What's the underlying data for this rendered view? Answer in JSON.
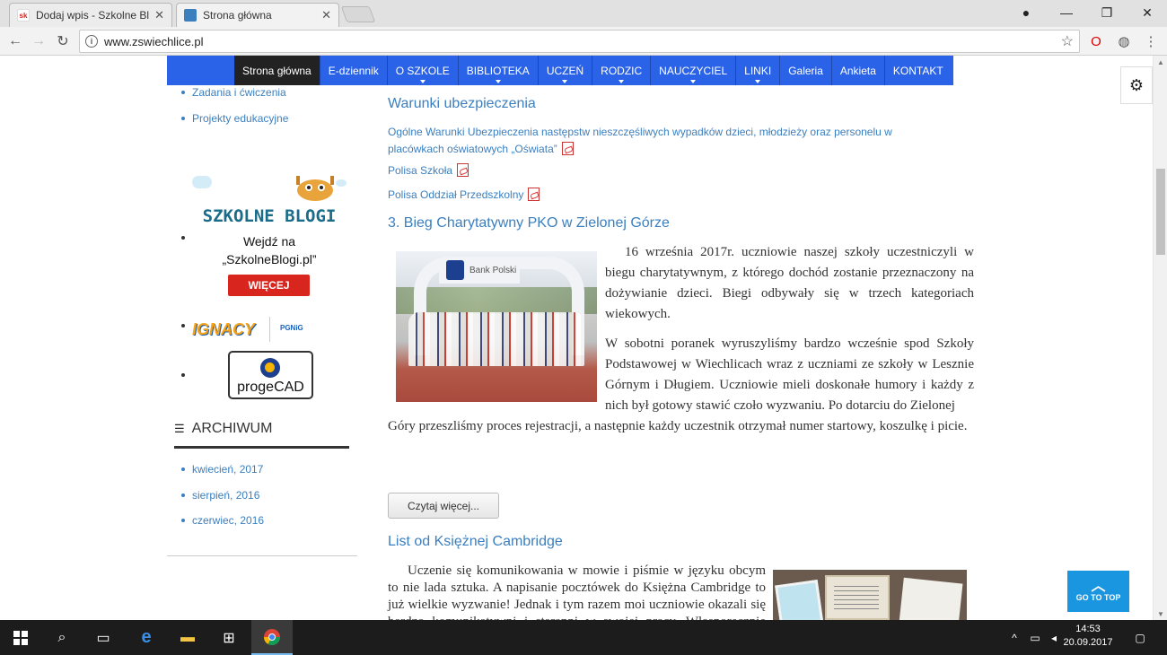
{
  "browser": {
    "tabs": [
      {
        "title": "Dodaj wpis - Szkolne Blo",
        "favicon": "sk"
      },
      {
        "title": "Strona główna",
        "favicon": "shield"
      }
    ],
    "url": "www.zswiechlice.pl"
  },
  "site_nav": {
    "items": [
      {
        "label": "Strona główna",
        "active": true,
        "dropdown": false
      },
      {
        "label": "E-dziennik",
        "active": false,
        "dropdown": false
      },
      {
        "label": "O SZKOLE",
        "active": false,
        "dropdown": true
      },
      {
        "label": "BIBLIOTEKA",
        "active": false,
        "dropdown": true
      },
      {
        "label": "UCZEŃ",
        "active": false,
        "dropdown": true
      },
      {
        "label": "RODZIC",
        "active": false,
        "dropdown": true
      },
      {
        "label": "NAUCZYCIEL",
        "active": false,
        "dropdown": true
      },
      {
        "label": "LINKI",
        "active": false,
        "dropdown": true
      },
      {
        "label": "Galeria",
        "active": false,
        "dropdown": false
      },
      {
        "label": "Ankieta",
        "active": false,
        "dropdown": false
      },
      {
        "label": "KONTAKT",
        "active": false,
        "dropdown": false
      }
    ]
  },
  "sidebar": {
    "links": [
      "Zadania i ćwiczenia",
      "Projekty edukacyjne"
    ],
    "szkolne_blogi": {
      "title": "SZKOLNE BLOGI",
      "line1": "Wejdź na",
      "line2": "„SzkolneBlogi.pl”",
      "button": "WIĘCEJ"
    },
    "ignacy": {
      "logo_text": "IGNACY",
      "sponsor_text": "PGNiG"
    },
    "progecad": {
      "label": "progeCAD"
    },
    "archive": {
      "title": "ARCHIWUM",
      "items": [
        "kwiecień, 2017",
        "sierpień, 2016",
        "czerwiec, 2016"
      ]
    }
  },
  "main": {
    "insurance": {
      "title": "Warunki ubezpieczenia",
      "links": [
        "Ogólne Warunki Ubezpieczenia następstw nieszczęśliwych wypadków dzieci, młodzieży oraz personelu w placówkach oświatowych „Oświata”",
        "Polisa Szkoła",
        "Polisa Oddział Przedszkolny"
      ]
    },
    "article1": {
      "title": "3. Bieg Charytatywny PKO w Zielonej Górze",
      "photo_banner": "Bank Polski",
      "para1": "16 września 2017r. uczniowie naszej szkoły uczestniczyli w biegu charytatywnym, z którego dochód zostanie przeznaczony na dożywianie dzieci. Biegi odbywały się w trzech kategoriach wiekowych.",
      "para2": "W sobotni poranek wyruszyliśmy bardzo wcześnie spod Szkoły Podstawowej w Wiechlicach wraz z uczniami ze szkoły w Lesznie Górnym i Długiem. Uczniowie mieli doskonałe humory i każdy z nich był gotowy stawić czoło wyzwaniu. Po dotarciu do Zielonej",
      "para2b": "Góry przeszliśmy proces rejestracji, a następnie każdy uczestnik otrzymał numer startowy, koszulkę i picie.",
      "read_more": "Czytaj więcej..."
    },
    "article2": {
      "title": "List od Księżnej Cambridge",
      "para1": "Uczenie się komunikowania w mowie i piśmie w języku obcym to nie lada sztuka. A napisanie pocztówek do Księżna Cambridge to już wielkie wyzwanie! Jednak i tym razem moi uczniowie okazali się bardzo komunikatywni i staranni w swojej pracy. Własnoręcznie przygotowali kartki, a następnie sformułowaliśmy treść pocztówek."
    },
    "go_to_top": "GO TO TOP"
  },
  "taskbar": {
    "time": "14:53",
    "date": "20.09.2017"
  },
  "colors": {
    "nav_blue": "#2a63e8",
    "link_blue": "#3b7fbf",
    "go_top_blue": "#1a96e0",
    "button_red": "#d8261f"
  }
}
